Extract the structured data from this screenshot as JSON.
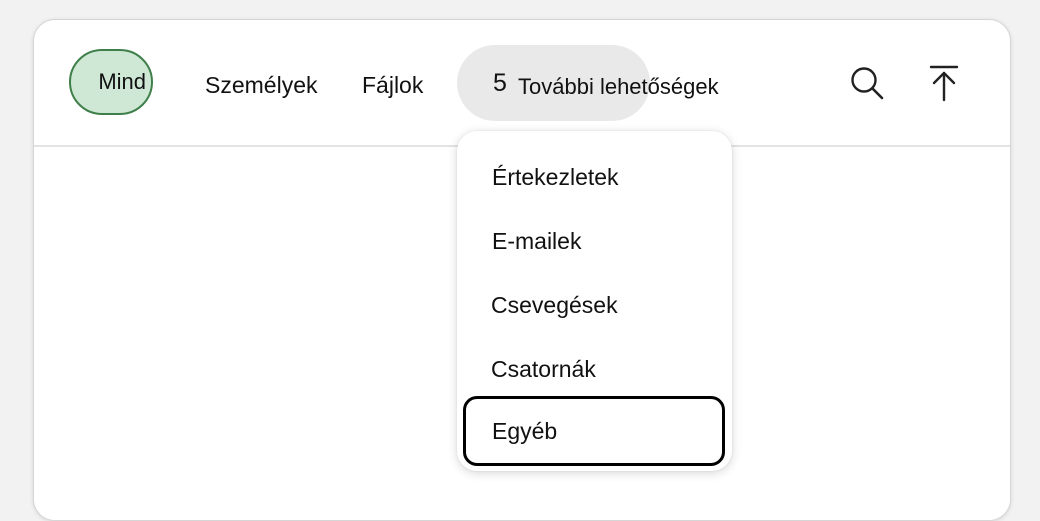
{
  "filters": {
    "all_label": "Mind",
    "people_label": "Személyek",
    "files_label": "Fájlok",
    "more_count": "5",
    "more_label": "További lehetőségek"
  },
  "icons": {
    "search": "search-icon",
    "collapse": "arrow-up-to-top-icon"
  },
  "dropdown": {
    "items": [
      {
        "label": "Értekezletek"
      },
      {
        "label": "E-mailek"
      },
      {
        "label": "Csevegések"
      },
      {
        "label": "Csatornák"
      },
      {
        "label": "Egyéb"
      }
    ],
    "focused_item": "Egyéb"
  },
  "colors": {
    "all_pill_bg": "#cfe8d6",
    "all_pill_border": "#3f7f4a",
    "more_pill_bg": "#e9e9e9",
    "focus_ring": "#000000"
  }
}
